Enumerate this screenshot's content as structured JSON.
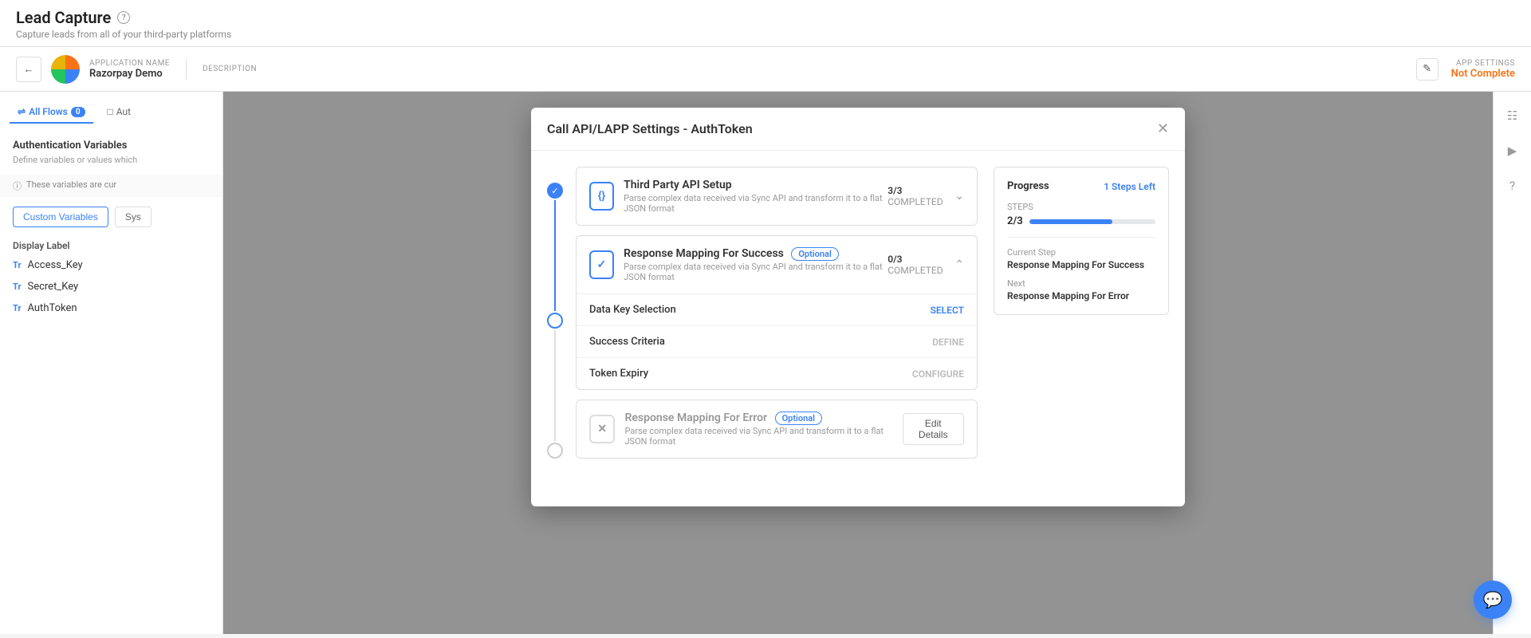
{
  "page": {
    "title": "Lead Capture",
    "subtitle": "Capture leads from all of your third-party platforms"
  },
  "appBar": {
    "app_name_label": "APPLICATION NAME",
    "app_name": "Razorpay Demo",
    "description_label": "DESCRIPTION",
    "app_settings_label": "APP SETTINGS",
    "app_settings_status": "Not Complete"
  },
  "sidebar": {
    "tabs": [
      {
        "label": "All Flows",
        "badge": "0",
        "active": true
      },
      {
        "label": "Aut",
        "active": false
      }
    ],
    "section_title": "Authentication Variables",
    "section_subtitle": "Define variables or values which",
    "note": "These variables are cur",
    "btn_custom": "Custom Variables",
    "btn_sys": "Sys",
    "display_label": "Display Label",
    "variables": [
      {
        "type": "Tr",
        "name": "Access_Key"
      },
      {
        "type": "Tr",
        "name": "Secret_Key"
      },
      {
        "type": "Tr",
        "name": "AuthToken"
      }
    ]
  },
  "modal": {
    "title": "Call API/LAPP Settings - AuthToken",
    "steps": [
      {
        "id": "step1",
        "icon": "{}",
        "title": "Third Party API Setup",
        "subtitle": "Parse complex data received via Sync API and transform it to a flat JSON format",
        "completed": "3/3",
        "completed_label": "COMPLETED",
        "optional": false,
        "expanded": false,
        "status": "done"
      },
      {
        "id": "step2",
        "icon": "✓",
        "title": "Response Mapping For Success",
        "subtitle": "Parse complex data received via Sync API and transform it to a flat JSON format",
        "completed": "0/3",
        "completed_label": "COMPLETED",
        "optional": true,
        "optional_label": "Optional",
        "expanded": true,
        "status": "active",
        "sub_steps": [
          {
            "label": "Data Key Selection",
            "action": "SELECT",
            "muted": false
          },
          {
            "label": "Success Criteria",
            "action": "DEFINE",
            "muted": true
          },
          {
            "label": "Token Expiry",
            "action": "CONFIGURE",
            "muted": true
          }
        ]
      },
      {
        "id": "step3",
        "icon": "✕",
        "title": "Response Mapping For Error",
        "subtitle": "Parse complex data received via Sync API and transform it to a flat JSON format",
        "optional": true,
        "optional_label": "Optional",
        "expanded": false,
        "status": "inactive",
        "edit_label": "Edit Details"
      }
    ]
  },
  "progress": {
    "title": "Progress",
    "steps_left": "1 Steps Left",
    "steps_label": "STEPS",
    "steps_value": "2/3",
    "progress_pct": 66,
    "current_label": "Current Step",
    "current_value": "Response Mapping For Success",
    "next_label": "Next",
    "next_value": "Response Mapping For Error"
  },
  "rightSidebar": {
    "icons": [
      "doc",
      "play",
      "help"
    ]
  }
}
